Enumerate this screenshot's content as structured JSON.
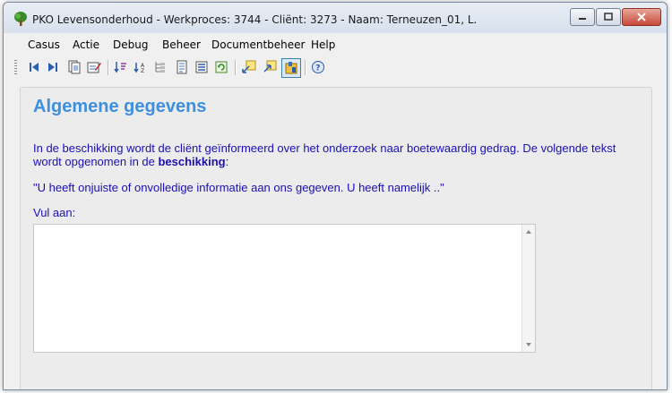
{
  "window": {
    "title": "PKO Levensonderhoud - Werkproces: 3744 - Cliënt: 3273 - Naam: Terneuzen_01, L."
  },
  "menu": [
    {
      "label": "Casus"
    },
    {
      "label": "Actie"
    },
    {
      "label": "Debug"
    },
    {
      "label": "Beheer"
    },
    {
      "label": "Documentbeheer"
    },
    {
      "label": "Help"
    }
  ],
  "toolbar": [
    {
      "icon": "first-icon"
    },
    {
      "icon": "last-icon"
    },
    {
      "icon": "documents-icon"
    },
    {
      "icon": "edit-icon"
    },
    {
      "icon": "sort-down-icon"
    },
    {
      "icon": "sort-az-icon"
    },
    {
      "icon": "tree-icon"
    },
    {
      "icon": "page-icon"
    },
    {
      "icon": "list-icon"
    },
    {
      "icon": "refresh-icon"
    },
    {
      "icon": "note-in-icon"
    },
    {
      "icon": "note-out-icon"
    },
    {
      "icon": "database-icon",
      "active": true
    },
    {
      "icon": "help-icon"
    }
  ],
  "content": {
    "heading": "Algemene gegevens",
    "paragraph_pre": "In de beschikking wordt de cliënt geïnformeerd over het onderzoek naar boetewaardig gedrag. De volgende tekst wordt opgenomen in de ",
    "paragraph_bold": "beschikking",
    "paragraph_post": ":",
    "quote": "\"U heeft onjuiste of onvolledige informatie aan ons gegeven. U heeft namelijk ..\"",
    "fill_label": "Vul aan:",
    "fill_value": ""
  },
  "colors": {
    "heading": "#3d8fe0",
    "body_text": "#1a0fb5"
  }
}
